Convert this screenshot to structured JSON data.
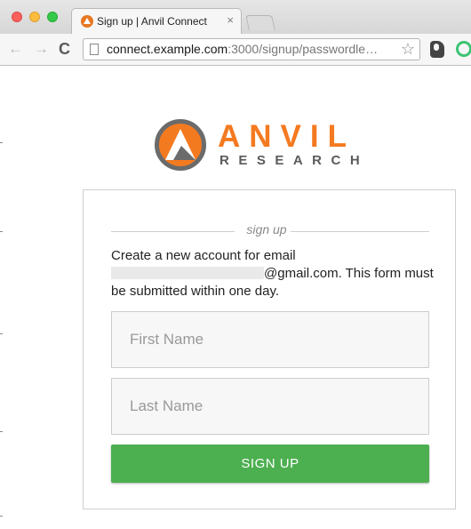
{
  "browser": {
    "tab_title": "Sign up | Anvil Connect",
    "tab_close": "×",
    "url_host": "connect.example.com",
    "url_path": ":3000/signup/passwordle…",
    "icons": {
      "back": "←",
      "forward": "→",
      "reload": "C",
      "bookmark": "☆"
    }
  },
  "logo": {
    "name": "ANVIL",
    "tagline": "RESEARCH",
    "colors": {
      "orange": "#f47a20",
      "gray": "#5b5b5b"
    }
  },
  "form": {
    "heading": "sign up",
    "intro_before_email": "Create a new account for email",
    "email_domain": "@gmail.com",
    "intro_after_email": ". This form must be submitted within one day.",
    "first_name_placeholder": "First Name",
    "first_name_value": "",
    "last_name_placeholder": "Last Name",
    "last_name_value": "",
    "submit_label": "SIGN UP",
    "colors": {
      "button": "#4caf50"
    }
  }
}
